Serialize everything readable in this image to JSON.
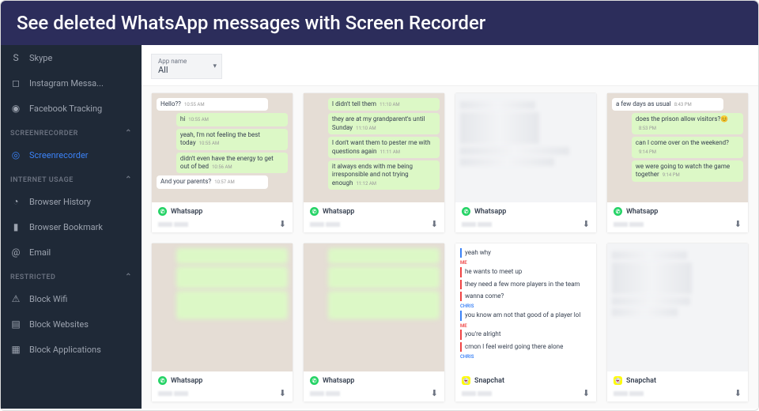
{
  "banner": "See deleted WhatsApp messages with Screen Recorder",
  "sidebar": {
    "top": [
      {
        "icon": "skype",
        "label": "Skype"
      },
      {
        "icon": "instagram",
        "label": "Instagram Messa..."
      },
      {
        "icon": "fb",
        "label": "Facebook Tracking"
      }
    ],
    "sections": [
      {
        "title": "SCREENRECORDER",
        "items": [
          {
            "icon": "camera",
            "label": "Screenrecorder",
            "active": true
          }
        ]
      },
      {
        "title": "INTERNET USAGE",
        "items": [
          {
            "icon": "clock",
            "label": "Browser History"
          },
          {
            "icon": "bookmark",
            "label": "Browser Bookmark"
          },
          {
            "icon": "at",
            "label": "Email"
          }
        ]
      },
      {
        "title": "RESTRICTED",
        "items": [
          {
            "icon": "wifi",
            "label": "Block Wifi"
          },
          {
            "icon": "web",
            "label": "Block Websites"
          },
          {
            "icon": "apps",
            "label": "Block Applications"
          }
        ]
      }
    ]
  },
  "filter": {
    "label": "App name",
    "value": "All"
  },
  "cards": [
    {
      "type": "whatsapp",
      "footer": "Whatsapp",
      "messages": [
        {
          "side": "in",
          "text": "Hello??",
          "time": "10:55 AM"
        },
        {
          "side": "out",
          "text": "hi",
          "time": "10:55 AM"
        },
        {
          "side": "out",
          "text": "yeah, I'm not feeling the best today",
          "time": "10:55 AM"
        },
        {
          "side": "out",
          "text": "didn't even have the energy to get out of bed",
          "time": "10:56 AM"
        },
        {
          "side": "in",
          "text": "And your parents?",
          "time": "10:57 AM"
        }
      ]
    },
    {
      "type": "whatsapp",
      "footer": "Whatsapp",
      "messages": [
        {
          "side": "out",
          "text": "I didn't tell them",
          "time": "11:10 AM"
        },
        {
          "side": "out",
          "text": "they are at my grandparent's until Sunday",
          "time": "11:10 AM"
        },
        {
          "side": "out",
          "text": "I don't want them to pester me with questions again",
          "time": "11:11 AM"
        },
        {
          "side": "out",
          "text": "it always ends with me being irresponsible and not trying enough",
          "time": "11:12 AM"
        }
      ]
    },
    {
      "type": "redacted",
      "footer": "Whatsapp"
    },
    {
      "type": "whatsapp",
      "footer": "Whatsapp",
      "messages": [
        {
          "side": "in",
          "text": "a few days as usual",
          "time": "8:43 PM"
        },
        {
          "side": "out",
          "text": "does the prison allow visitors?😊",
          "time": "8:53 PM"
        },
        {
          "side": "out",
          "text": "can I come over on the weekend?",
          "time": "9:14 PM"
        },
        {
          "side": "out",
          "text": "we were going to watch the game together",
          "time": "9:14 PM"
        }
      ]
    },
    {
      "type": "redacted-wa",
      "footer": "Whatsapp"
    },
    {
      "type": "redacted-wa",
      "footer": "Whatsapp"
    },
    {
      "type": "snapchat",
      "footer": "Snapchat",
      "lines": [
        {
          "who": "other",
          "name": "",
          "text": "yeah why"
        },
        {
          "who": "me",
          "name": "ME",
          "text": "he wants to meet up"
        },
        {
          "who": "me",
          "name": "",
          "text": "they need a few more players in the team"
        },
        {
          "who": "me",
          "name": "",
          "text": "wanna come?"
        },
        {
          "who": "other",
          "name": "CHRIS",
          "text": "you know am not that good of a player lol"
        },
        {
          "who": "me",
          "name": "ME",
          "text": "you're alright"
        },
        {
          "who": "me",
          "name": "",
          "text": "cmon I feel weird going there alone"
        },
        {
          "who": "other",
          "name": "CHRIS",
          "text": ""
        }
      ]
    },
    {
      "type": "redacted",
      "footer": "Snapchat"
    }
  ]
}
